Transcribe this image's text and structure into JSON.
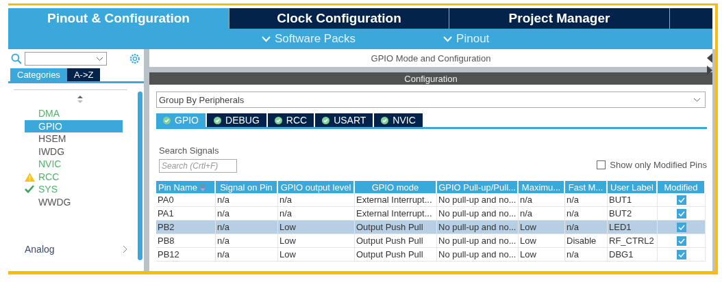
{
  "main_tabs": [
    {
      "label": "Pinout & Configuration",
      "selected": true
    },
    {
      "label": "Clock Configuration",
      "selected": false
    },
    {
      "label": "Project Manager",
      "selected": false
    }
  ],
  "sub_menus": [
    {
      "label": "Software Packs"
    },
    {
      "label": "Pinout"
    }
  ],
  "sidebar": {
    "view_tabs": [
      {
        "label": "Categories",
        "selected": true
      },
      {
        "label": "A->Z",
        "selected": false
      }
    ],
    "items": [
      {
        "label": "DMA",
        "configured": true,
        "selected": false,
        "warning": false,
        "ok": false
      },
      {
        "label": "GPIO",
        "configured": true,
        "selected": true,
        "warning": false,
        "ok": false
      },
      {
        "label": "HSEM",
        "configured": false,
        "selected": false,
        "warning": false,
        "ok": false
      },
      {
        "label": "IWDG",
        "configured": false,
        "selected": false,
        "warning": false,
        "ok": false
      },
      {
        "label": "NVIC",
        "configured": true,
        "selected": false,
        "warning": false,
        "ok": false
      },
      {
        "label": "RCC",
        "configured": true,
        "selected": false,
        "warning": true,
        "ok": false
      },
      {
        "label": "SYS",
        "configured": true,
        "selected": false,
        "warning": false,
        "ok": true
      },
      {
        "label": "WWDG",
        "configured": false,
        "selected": false,
        "warning": false,
        "ok": false
      }
    ],
    "groups": [
      {
        "label": "Analog"
      }
    ]
  },
  "panel": {
    "title": "GPIO Mode and Configuration",
    "section": "Configuration",
    "group_by": "Group By Peripherals",
    "tabs": [
      {
        "label": "GPIO",
        "selected": true
      },
      {
        "label": "DEBUG",
        "selected": false
      },
      {
        "label": "RCC",
        "selected": false
      },
      {
        "label": "USART",
        "selected": false
      },
      {
        "label": "NVIC",
        "selected": false
      }
    ],
    "search_label": "Search Signals",
    "search": {
      "placeholder": "Search (Crtl+F)"
    },
    "show_modified": {
      "label": "Show only Modified Pins",
      "checked": false
    },
    "table": {
      "columns": [
        "Pin Name",
        "Signal on Pin",
        "GPIO output level",
        "GPIO mode",
        "GPIO Pull-up/Pull...",
        "Maximu...",
        "Fast M...",
        "User Label",
        "Modified"
      ],
      "rows": [
        {
          "cells": [
            "PA0",
            "n/a",
            "n/a",
            "External Interrupt...",
            "No pull-up and no...",
            "n/a",
            "n/a",
            "BUT1"
          ],
          "modified": true,
          "selected": false
        },
        {
          "cells": [
            "PA1",
            "n/a",
            "n/a",
            "External Interrupt...",
            "No pull-up and no...",
            "n/a",
            "n/a",
            "BUT2"
          ],
          "modified": true,
          "selected": false
        },
        {
          "cells": [
            "PB2",
            "n/a",
            "Low",
            "Output Push Pull",
            "No pull-up and no...",
            "Low",
            "n/a",
            "LED1"
          ],
          "modified": true,
          "selected": true
        },
        {
          "cells": [
            "PB8",
            "n/a",
            "Low",
            "Output Push Pull",
            "No pull-up and no...",
            "Low",
            "Disable",
            "RF_CTRL2"
          ],
          "modified": true,
          "selected": false
        },
        {
          "cells": [
            "PB12",
            "n/a",
            "Low",
            "Output Push Pull",
            "No pull-up and no...",
            "Low",
            "n/a",
            "DBG1"
          ],
          "modified": true,
          "selected": false
        }
      ]
    }
  }
}
